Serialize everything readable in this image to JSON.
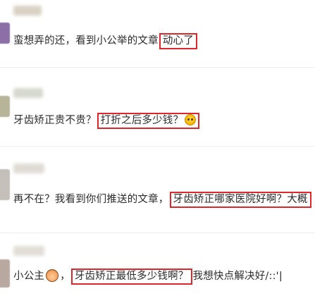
{
  "comments": [
    {
      "text_before": "蛮想弄的还，看到小公举的文章",
      "highlight": "动心了",
      "text_after": ""
    },
    {
      "text_before": "牙齿矫正贵不贵？",
      "highlight": "打折之后多少钱？",
      "text_after": ""
    },
    {
      "text_before": "再不在？我看到你们推送的文章，",
      "highlight": "牙齿矫正哪家医院好啊？大概",
      "text_after": ""
    },
    {
      "text_before": "小公主",
      "separator": "，",
      "highlight": "牙齿矫正最低多少钱啊？",
      "text_after": "我想快点解决好/::'|"
    }
  ],
  "colors": {
    "highlight_border": "#e0262b",
    "divider": "#ececec"
  },
  "icons": {
    "avatar": "avatar",
    "emoji_1": "smiley-emoji-icon",
    "emoji_2": "girl-emoji-icon"
  }
}
